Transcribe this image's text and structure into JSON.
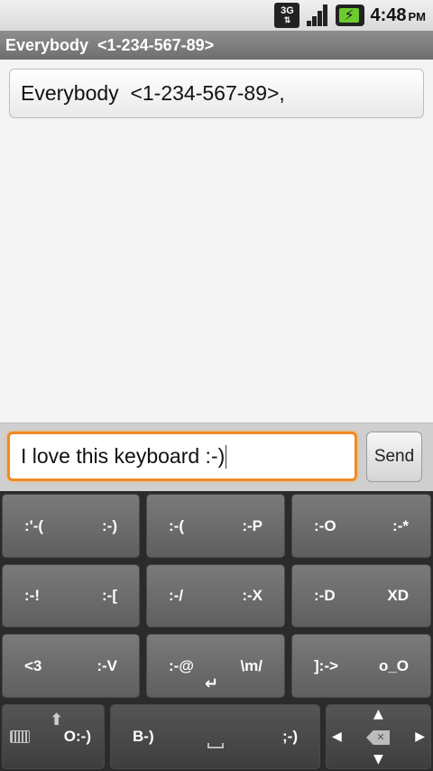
{
  "status_bar": {
    "network": "3G",
    "time": "4:48",
    "ampm": "PM",
    "icons": [
      "3g-icon",
      "signal-icon",
      "battery-charging-icon"
    ]
  },
  "title_bar": {
    "title": "Everybody  <1-234-567-89>"
  },
  "recipients": {
    "value": "Everybody  <1-234-567-89>,"
  },
  "compose": {
    "message": "I love this keyboard :-)",
    "send_label": "Send",
    "focus_color": "#f08a24"
  },
  "keyboard": {
    "rows": [
      [
        [
          ":'-(",
          ":-)"
        ],
        [
          ":-(",
          ":-P"
        ],
        [
          ":-O",
          ":-*"
        ]
      ],
      [
        [
          ":-!",
          ":-["
        ],
        [
          ":-/",
          ":-X"
        ],
        [
          ":-D",
          "XD"
        ]
      ],
      [
        [
          "<3",
          ":-V"
        ],
        [
          ":-@",
          "\\m/"
        ],
        [
          "]:->",
          "o_O"
        ]
      ]
    ],
    "bottom": {
      "mode_key": "O:-)",
      "space_left": "B-)",
      "space_right": ";-)"
    }
  }
}
